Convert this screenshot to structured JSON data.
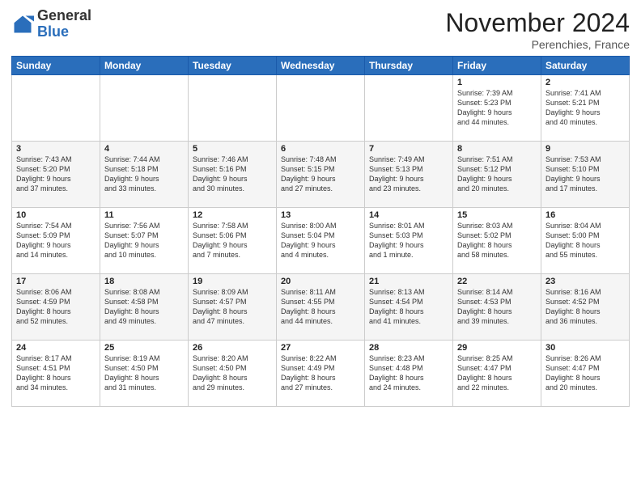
{
  "header": {
    "logo_general": "General",
    "logo_blue": "Blue",
    "month_title": "November 2024",
    "location": "Perenchies, France"
  },
  "days_of_week": [
    "Sunday",
    "Monday",
    "Tuesday",
    "Wednesday",
    "Thursday",
    "Friday",
    "Saturday"
  ],
  "weeks": [
    [
      {
        "day": "",
        "info": ""
      },
      {
        "day": "",
        "info": ""
      },
      {
        "day": "",
        "info": ""
      },
      {
        "day": "",
        "info": ""
      },
      {
        "day": "",
        "info": ""
      },
      {
        "day": "1",
        "info": "Sunrise: 7:39 AM\nSunset: 5:23 PM\nDaylight: 9 hours\nand 44 minutes."
      },
      {
        "day": "2",
        "info": "Sunrise: 7:41 AM\nSunset: 5:21 PM\nDaylight: 9 hours\nand 40 minutes."
      }
    ],
    [
      {
        "day": "3",
        "info": "Sunrise: 7:43 AM\nSunset: 5:20 PM\nDaylight: 9 hours\nand 37 minutes."
      },
      {
        "day": "4",
        "info": "Sunrise: 7:44 AM\nSunset: 5:18 PM\nDaylight: 9 hours\nand 33 minutes."
      },
      {
        "day": "5",
        "info": "Sunrise: 7:46 AM\nSunset: 5:16 PM\nDaylight: 9 hours\nand 30 minutes."
      },
      {
        "day": "6",
        "info": "Sunrise: 7:48 AM\nSunset: 5:15 PM\nDaylight: 9 hours\nand 27 minutes."
      },
      {
        "day": "7",
        "info": "Sunrise: 7:49 AM\nSunset: 5:13 PM\nDaylight: 9 hours\nand 23 minutes."
      },
      {
        "day": "8",
        "info": "Sunrise: 7:51 AM\nSunset: 5:12 PM\nDaylight: 9 hours\nand 20 minutes."
      },
      {
        "day": "9",
        "info": "Sunrise: 7:53 AM\nSunset: 5:10 PM\nDaylight: 9 hours\nand 17 minutes."
      }
    ],
    [
      {
        "day": "10",
        "info": "Sunrise: 7:54 AM\nSunset: 5:09 PM\nDaylight: 9 hours\nand 14 minutes."
      },
      {
        "day": "11",
        "info": "Sunrise: 7:56 AM\nSunset: 5:07 PM\nDaylight: 9 hours\nand 10 minutes."
      },
      {
        "day": "12",
        "info": "Sunrise: 7:58 AM\nSunset: 5:06 PM\nDaylight: 9 hours\nand 7 minutes."
      },
      {
        "day": "13",
        "info": "Sunrise: 8:00 AM\nSunset: 5:04 PM\nDaylight: 9 hours\nand 4 minutes."
      },
      {
        "day": "14",
        "info": "Sunrise: 8:01 AM\nSunset: 5:03 PM\nDaylight: 9 hours\nand 1 minute."
      },
      {
        "day": "15",
        "info": "Sunrise: 8:03 AM\nSunset: 5:02 PM\nDaylight: 8 hours\nand 58 minutes."
      },
      {
        "day": "16",
        "info": "Sunrise: 8:04 AM\nSunset: 5:00 PM\nDaylight: 8 hours\nand 55 minutes."
      }
    ],
    [
      {
        "day": "17",
        "info": "Sunrise: 8:06 AM\nSunset: 4:59 PM\nDaylight: 8 hours\nand 52 minutes."
      },
      {
        "day": "18",
        "info": "Sunrise: 8:08 AM\nSunset: 4:58 PM\nDaylight: 8 hours\nand 49 minutes."
      },
      {
        "day": "19",
        "info": "Sunrise: 8:09 AM\nSunset: 4:57 PM\nDaylight: 8 hours\nand 47 minutes."
      },
      {
        "day": "20",
        "info": "Sunrise: 8:11 AM\nSunset: 4:55 PM\nDaylight: 8 hours\nand 44 minutes."
      },
      {
        "day": "21",
        "info": "Sunrise: 8:13 AM\nSunset: 4:54 PM\nDaylight: 8 hours\nand 41 minutes."
      },
      {
        "day": "22",
        "info": "Sunrise: 8:14 AM\nSunset: 4:53 PM\nDaylight: 8 hours\nand 39 minutes."
      },
      {
        "day": "23",
        "info": "Sunrise: 8:16 AM\nSunset: 4:52 PM\nDaylight: 8 hours\nand 36 minutes."
      }
    ],
    [
      {
        "day": "24",
        "info": "Sunrise: 8:17 AM\nSunset: 4:51 PM\nDaylight: 8 hours\nand 34 minutes."
      },
      {
        "day": "25",
        "info": "Sunrise: 8:19 AM\nSunset: 4:50 PM\nDaylight: 8 hours\nand 31 minutes."
      },
      {
        "day": "26",
        "info": "Sunrise: 8:20 AM\nSunset: 4:50 PM\nDaylight: 8 hours\nand 29 minutes."
      },
      {
        "day": "27",
        "info": "Sunrise: 8:22 AM\nSunset: 4:49 PM\nDaylight: 8 hours\nand 27 minutes."
      },
      {
        "day": "28",
        "info": "Sunrise: 8:23 AM\nSunset: 4:48 PM\nDaylight: 8 hours\nand 24 minutes."
      },
      {
        "day": "29",
        "info": "Sunrise: 8:25 AM\nSunset: 4:47 PM\nDaylight: 8 hours\nand 22 minutes."
      },
      {
        "day": "30",
        "info": "Sunrise: 8:26 AM\nSunset: 4:47 PM\nDaylight: 8 hours\nand 20 minutes."
      }
    ]
  ]
}
